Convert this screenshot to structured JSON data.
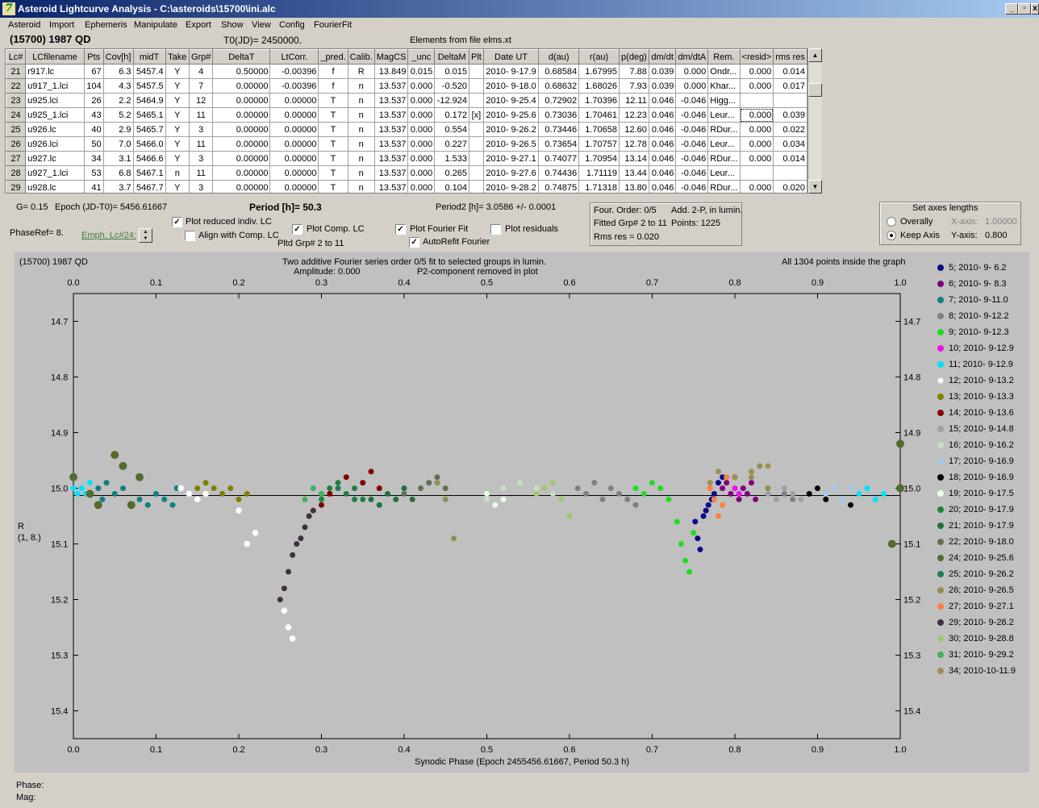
{
  "window": {
    "title": "Asteroid Lightcurve Analysis - C:\\asteroids\\15700\\ini.alc",
    "minimize": "_",
    "restore": "▫",
    "close": "x"
  },
  "menu": [
    "Asteroid",
    "Import",
    "Ephemeris",
    "Manipulate",
    "Export",
    "Show",
    "View",
    "Config",
    "FourierFit"
  ],
  "info": {
    "object": "(15700) 1987 QD",
    "t0": "T0(JD)= 2450000.",
    "elements": "Elements from file elms.xt"
  },
  "table": {
    "headers": [
      "Lc#",
      "LCfilename",
      "Pts",
      "Cov[h]",
      "midT",
      "Take",
      "Grp#",
      "DeltaT",
      "LtCorr.",
      "_pred.",
      "Calib.",
      "MagCS",
      "_unc",
      "DeltaM",
      "Plt",
      "Date UT",
      "d(au)",
      "r(au)",
      "p(deg)",
      "dm/dt",
      "dm/dtA",
      "Rem.",
      "<resid>",
      "rms res"
    ],
    "rows": [
      [
        "21",
        "r917.lc",
        "67",
        "6.3",
        "5457.4",
        "Y",
        "4",
        "0.50000",
        "-0.00396",
        "f",
        "R",
        "13.849",
        "0.015",
        "0.015",
        "",
        "2010- 9-17.9",
        "0.68584",
        "1.67995",
        "7.88",
        "0.039",
        "0.000",
        "Ondr...",
        "0.000",
        "0.014"
      ],
      [
        "22",
        "u917_1.lci",
        "104",
        "4.3",
        "5457.5",
        "Y",
        "7",
        "0.00000",
        "-0.00396",
        "f",
        "n",
        "13.537",
        "0.000",
        "-0.520",
        "",
        "2010- 9-18.0",
        "0.68632",
        "1.68026",
        "7.93",
        "0.039",
        "0.000",
        "Khar...",
        "0.000",
        "0.017"
      ],
      [
        "23",
        "u925.lci",
        "26",
        "2.2",
        "5464.9",
        "Y",
        "12",
        "0.00000",
        "0.00000",
        "T",
        "n",
        "13.537",
        "0.000",
        "-12.924",
        "",
        "2010- 9-25.4",
        "0.72902",
        "1.70396",
        "12.11",
        "0.046",
        "-0.046",
        "Higg...",
        "",
        ""
      ],
      [
        "24",
        "u925_1.lci",
        "43",
        "5.2",
        "5465.1",
        "Y",
        "11",
        "0.00000",
        "0.00000",
        "T",
        "n",
        "13.537",
        "0.000",
        "0.172",
        "[x]",
        "2010- 9-25.6",
        "0.73036",
        "1.70461",
        "12.23",
        "0.046",
        "-0.046",
        "Leur...",
        "0.000",
        "0.039"
      ],
      [
        "25",
        "u926.lc",
        "40",
        "2.9",
        "5465.7",
        "Y",
        "3",
        "0.00000",
        "0.00000",
        "T",
        "n",
        "13.537",
        "0.000",
        "0.554",
        "",
        "2010- 9-26.2",
        "0.73446",
        "1.70658",
        "12.60",
        "0.046",
        "-0.046",
        "RDur...",
        "0.000",
        "0.022"
      ],
      [
        "26",
        "u926.lci",
        "50",
        "7.0",
        "5466.0",
        "Y",
        "11",
        "0.00000",
        "0.00000",
        "T",
        "n",
        "13.537",
        "0.000",
        "0.227",
        "",
        "2010- 9-26.5",
        "0.73654",
        "1.70757",
        "12.78",
        "0.046",
        "-0.046",
        "Leur...",
        "0.000",
        "0.034"
      ],
      [
        "27",
        "u927.lc",
        "34",
        "3.1",
        "5466.6",
        "Y",
        "3",
        "0.00000",
        "0.00000",
        "T",
        "n",
        "13.537",
        "0.000",
        "1.533",
        "",
        "2010- 9-27.1",
        "0.74077",
        "1.70954",
        "13.14",
        "0.046",
        "-0.046",
        "RDur...",
        "0.000",
        "0.014"
      ],
      [
        "28",
        "u927_1.lci",
        "53",
        "6.8",
        "5467.1",
        "n",
        "11",
        "0.00000",
        "0.00000",
        "T",
        "n",
        "13.537",
        "0.000",
        "0.265",
        "",
        "2010- 9-27.6",
        "0.74436",
        "1.71119",
        "13.44",
        "0.046",
        "-0.046",
        "Leur...",
        "",
        ""
      ],
      [
        "29",
        "u928.lc",
        "41",
        "3.7",
        "5467.7",
        "Y",
        "3",
        "0.00000",
        "0.00000",
        "T",
        "n",
        "13.537",
        "0.000",
        "0.104",
        "",
        "2010- 9-28.2",
        "0.74875",
        "1.71318",
        "13.80",
        "0.046",
        "-0.046",
        "RDur...",
        "0.000",
        "0.020"
      ]
    ]
  },
  "params": {
    "g": "G= 0.15",
    "epoch": "Epoch (JD-T0)= 5456.61667",
    "period": "Period [h]= 50.3",
    "period2": "Period2 [h]= 3.0586 +/- 0.0001",
    "phaseref": "PhaseRef= 8.",
    "emph": "Emph. Lc#24:",
    "plot_reduced": "Plot reduced indiv. LC",
    "align": "Align with Comp. LC",
    "plot_comp": "Plot Comp. LC",
    "pltd_grp": "Pltd Grp#  2  to  11",
    "plot_fourier": "Plot Fourier Fit",
    "autorefit": "AutoRefit Fourier",
    "plot_residuals": "Plot residuals"
  },
  "fourier_box": {
    "order": "Four. Order:  0/5",
    "add": "Add. 2-P, in lumin.",
    "fitted": "Fitted Grp# 2 to 11",
    "points": "Points: 1225",
    "rms": "Rms res      = 0.020"
  },
  "axes_box": {
    "title": "Set axes lengths",
    "overally": "Overally",
    "keep": "Keep Axis",
    "xaxis_label": "X-axis:",
    "xaxis_value": "1.00000",
    "yaxis_label": "Y-axis:",
    "yaxis_value": "0.800"
  },
  "plot": {
    "corner_title": "(15700) 1987 QD",
    "caption1": "Two additive Fourier series order 0/5 fit to selected groups in lumin.",
    "caption2": "Amplitude: 0.000                       P2-component removed in plot",
    "points_note": "All 1304 points inside the graph",
    "ylabel1": "R",
    "ylabel2": "(1, 8.)",
    "xlabel": "Synodic Phase (Epoch 2455456.61667, Period 50.3 h)"
  },
  "chart_data": {
    "type": "scatter",
    "xlim": [
      0.0,
      1.0
    ],
    "ylim": [
      15.45,
      14.65
    ],
    "x_ticks": [
      "0.0",
      "0.1",
      "0.2",
      "0.3",
      "0.4",
      "0.5",
      "0.6",
      "0.7",
      "0.8",
      "0.9",
      "1.0"
    ],
    "y_ticks": [
      "14.7",
      "14.8",
      "14.9",
      "15.0",
      "15.1",
      "15.2",
      "15.3",
      "15.4"
    ],
    "fit_line": 15.013,
    "series": [
      {
        "name": "5; 2010- 9- 6.2",
        "color": "#0a0a8a",
        "points": [
          [
            0.752,
            15.06
          ],
          [
            0.755,
            15.09
          ],
          [
            0.758,
            15.11
          ],
          [
            0.762,
            15.05
          ],
          [
            0.765,
            15.04
          ],
          [
            0.768,
            15.03
          ],
          [
            0.772,
            15.02
          ],
          [
            0.775,
            15.01
          ],
          [
            0.78,
            14.99
          ],
          [
            0.785,
            14.98
          ]
        ]
      },
      {
        "name": "6; 2010- 9- 8.3",
        "color": "#800080",
        "points": [
          [
            0.785,
            15.0
          ],
          [
            0.79,
            14.99
          ],
          [
            0.795,
            15.01
          ],
          [
            0.8,
            14.98
          ],
          [
            0.805,
            15.02
          ],
          [
            0.81,
            15.0
          ],
          [
            0.815,
            15.01
          ],
          [
            0.82,
            14.99
          ],
          [
            0.825,
            15.02
          ]
        ]
      },
      {
        "name": "7; 2010- 9-11.0",
        "color": "#108080",
        "points": [
          [
            0.03,
            15.0
          ],
          [
            0.035,
            15.02
          ],
          [
            0.04,
            14.99
          ],
          [
            0.05,
            15.01
          ],
          [
            0.06,
            15.0
          ],
          [
            0.08,
            15.02
          ],
          [
            0.09,
            15.03
          ],
          [
            0.1,
            15.01
          ],
          [
            0.11,
            15.02
          ],
          [
            0.12,
            15.03
          ],
          [
            0.125,
            15.0
          ]
        ]
      },
      {
        "name": "8; 2010- 9-12.2",
        "color": "#808080",
        "points": [
          [
            0.61,
            15.0
          ],
          [
            0.62,
            15.01
          ],
          [
            0.63,
            14.99
          ],
          [
            0.64,
            15.02
          ],
          [
            0.65,
            15.0
          ],
          [
            0.66,
            15.01
          ],
          [
            0.67,
            15.02
          ],
          [
            0.68,
            15.03
          ],
          [
            0.86,
            15.01
          ],
          [
            0.87,
            15.02
          ]
        ]
      },
      {
        "name": "9; 2010- 9-12.3",
        "color": "#22dd22",
        "points": [
          [
            0.68,
            15.0
          ],
          [
            0.69,
            15.01
          ],
          [
            0.7,
            14.99
          ],
          [
            0.71,
            15.0
          ],
          [
            0.72,
            15.02
          ],
          [
            0.73,
            15.06
          ],
          [
            0.735,
            15.1
          ],
          [
            0.74,
            15.13
          ],
          [
            0.745,
            15.15
          ],
          [
            0.75,
            15.08
          ]
        ]
      },
      {
        "name": "10; 2010- 9-12.9",
        "color": "#ee10ee",
        "points": [
          [
            0.8,
            15.0
          ],
          [
            0.805,
            15.01
          ]
        ]
      },
      {
        "name": "11; 2010- 9-12.9",
        "color": "#00e0ff",
        "points": [
          [
            0.0,
            15.0
          ],
          [
            0.005,
            15.01
          ],
          [
            0.01,
            15.0
          ],
          [
            0.015,
            15.01
          ],
          [
            0.02,
            14.99
          ],
          [
            0.95,
            15.01
          ],
          [
            0.96,
            15.0
          ],
          [
            0.97,
            15.02
          ],
          [
            0.98,
            15.01
          ]
        ]
      },
      {
        "name": "12; 2010- 9-13.2",
        "color": "#ffffff",
        "points": [
          [
            0.13,
            15.0
          ],
          [
            0.14,
            15.01
          ],
          [
            0.15,
            15.02
          ],
          [
            0.16,
            15.01
          ],
          [
            0.2,
            15.04
          ],
          [
            0.21,
            15.1
          ],
          [
            0.22,
            15.08
          ],
          [
            0.255,
            15.22
          ],
          [
            0.26,
            15.25
          ],
          [
            0.265,
            15.27
          ]
        ]
      },
      {
        "name": "13; 2010- 9-13.3",
        "color": "#808000",
        "points": [
          [
            0.15,
            15.0
          ],
          [
            0.16,
            14.99
          ],
          [
            0.17,
            15.0
          ],
          [
            0.18,
            15.01
          ],
          [
            0.19,
            15.0
          ],
          [
            0.2,
            15.02
          ],
          [
            0.21,
            15.01
          ]
        ]
      },
      {
        "name": "14; 2010- 9-13.6",
        "color": "#800000",
        "points": [
          [
            0.3,
            15.03
          ],
          [
            0.31,
            15.01
          ],
          [
            0.33,
            14.98
          ],
          [
            0.35,
            14.99
          ],
          [
            0.36,
            14.97
          ],
          [
            0.37,
            15.0
          ]
        ]
      },
      {
        "name": "15; 2010- 9-14.8",
        "color": "#a0a0a0",
        "points": [
          [
            0.84,
            15.01
          ],
          [
            0.85,
            15.02
          ],
          [
            0.86,
            15.0
          ],
          [
            0.87,
            15.01
          ],
          [
            0.88,
            15.02
          ]
        ]
      },
      {
        "name": "16; 2010- 9-16.2",
        "color": "#c8dcc8",
        "points": [
          [
            0.5,
            15.02
          ],
          [
            0.52,
            15.0
          ],
          [
            0.54,
            14.99
          ],
          [
            0.56,
            15.0
          ],
          [
            0.58,
            15.01
          ]
        ]
      },
      {
        "name": "17; 2010- 9-16.9",
        "color": "#a8c8f0",
        "points": [
          [
            0.9,
            15.0
          ],
          [
            0.91,
            15.01
          ],
          [
            0.92,
            15.0
          ],
          [
            0.93,
            15.02
          ],
          [
            0.94,
            15.0
          ]
        ]
      },
      {
        "name": "18; 2010- 9-16.9",
        "color": "#000000",
        "points": [
          [
            0.89,
            15.01
          ],
          [
            0.9,
            15.0
          ],
          [
            0.91,
            15.02
          ],
          [
            0.94,
            15.03
          ]
        ]
      },
      {
        "name": "19; 2010- 9-17.5",
        "color": "#e8ffe8",
        "points": [
          [
            0.5,
            15.01
          ],
          [
            0.51,
            15.03
          ],
          [
            0.52,
            15.02
          ]
        ]
      },
      {
        "name": "20; 2010- 9-17.9",
        "color": "#208040",
        "points": [
          [
            0.3,
            15.02
          ],
          [
            0.31,
            15.0
          ],
          [
            0.32,
            14.99
          ],
          [
            0.33,
            15.01
          ],
          [
            0.34,
            15.0
          ],
          [
            0.35,
            15.02
          ]
        ]
      },
      {
        "name": "21; 2010- 9-17.9",
        "color": "#207040",
        "points": [
          [
            0.36,
            15.02
          ],
          [
            0.37,
            15.03
          ],
          [
            0.38,
            15.01
          ],
          [
            0.39,
            15.02
          ],
          [
            0.4,
            15.0
          ],
          [
            0.41,
            15.02
          ]
        ]
      },
      {
        "name": "22; 2010- 9-18.0",
        "color": "#607050",
        "points": [
          [
            0.4,
            15.01
          ],
          [
            0.42,
            15.0
          ],
          [
            0.43,
            14.99
          ],
          [
            0.44,
            14.98
          ],
          [
            0.45,
            15.0
          ]
        ]
      },
      {
        "name": "24; 2010- 9-25.6",
        "color": "#556b2f",
        "points": [
          [
            0.0,
            14.98
          ],
          [
            0.02,
            15.01
          ],
          [
            0.03,
            15.03
          ],
          [
            0.05,
            14.94
          ],
          [
            0.06,
            14.96
          ],
          [
            0.07,
            15.03
          ],
          [
            0.08,
            14.98
          ],
          [
            0.99,
            15.1
          ],
          [
            1.0,
            15.0
          ],
          [
            1.0,
            14.92
          ]
        ]
      },
      {
        "name": "25; 2010- 9-26.2",
        "color": "#1e7e4e",
        "points": [
          [
            0.3,
            15.01
          ],
          [
            0.32,
            15.0
          ],
          [
            0.34,
            15.02
          ]
        ]
      },
      {
        "name": "26; 2010- 9-26.5",
        "color": "#909050",
        "points": [
          [
            0.44,
            14.99
          ],
          [
            0.45,
            15.02
          ],
          [
            0.46,
            15.09
          ],
          [
            0.82,
            14.98
          ],
          [
            0.83,
            14.96
          ],
          [
            0.84,
            15.0
          ]
        ]
      },
      {
        "name": "27; 2010- 9-27.1",
        "color": "#ff8040",
        "points": [
          [
            0.77,
            15.0
          ],
          [
            0.775,
            15.02
          ],
          [
            0.78,
            15.05
          ],
          [
            0.785,
            15.03
          ],
          [
            0.79,
            14.98
          ]
        ]
      },
      {
        "name": "29; 2010- 9-28.2",
        "color": "#403040",
        "points": [
          [
            0.25,
            15.2
          ],
          [
            0.255,
            15.18
          ],
          [
            0.26,
            15.15
          ],
          [
            0.265,
            15.12
          ],
          [
            0.27,
            15.1
          ],
          [
            0.275,
            15.09
          ],
          [
            0.28,
            15.07
          ],
          [
            0.285,
            15.05
          ],
          [
            0.29,
            15.04
          ]
        ]
      },
      {
        "name": "30; 2010- 9-28.8",
        "color": "#a0c870",
        "points": [
          [
            0.56,
            15.01
          ],
          [
            0.57,
            15.0
          ],
          [
            0.58,
            14.99
          ],
          [
            0.59,
            15.02
          ],
          [
            0.6,
            15.05
          ]
        ]
      },
      {
        "name": "31; 2010- 9-29.2",
        "color": "#40b060",
        "points": [
          [
            0.28,
            15.02
          ],
          [
            0.29,
            15.0
          ],
          [
            0.3,
            15.01
          ]
        ]
      },
      {
        "name": "34; 2010-10-11.9",
        "color": "#a09050",
        "points": [
          [
            0.77,
            14.99
          ],
          [
            0.78,
            14.97
          ],
          [
            0.8,
            14.98
          ],
          [
            0.82,
            14.97
          ],
          [
            0.84,
            14.96
          ]
        ]
      }
    ]
  }
}
